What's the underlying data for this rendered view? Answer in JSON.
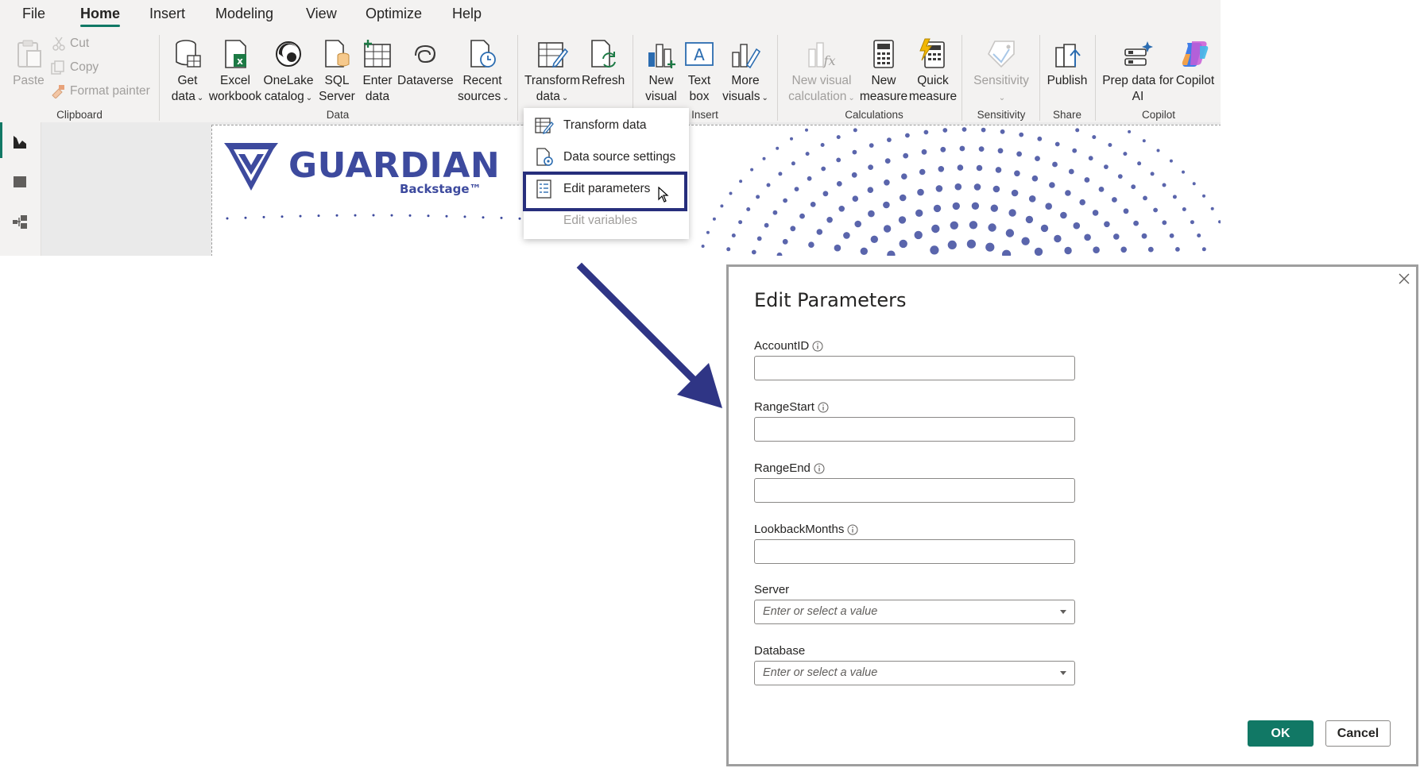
{
  "menu": {
    "tabs": [
      "File",
      "Home",
      "Insert",
      "Modeling",
      "View",
      "Optimize",
      "Help"
    ],
    "active_tab": "Home"
  },
  "ribbon": {
    "clipboard": {
      "paste": "Paste",
      "cut": "Cut",
      "copy": "Copy",
      "format_painter": "Format painter",
      "label": "Clipboard"
    },
    "data": {
      "get_data": [
        "Get",
        "data"
      ],
      "excel_workbook": [
        "Excel",
        "workbook"
      ],
      "onelake_catalog": [
        "OneLake",
        "catalog"
      ],
      "sql_server": [
        "SQL",
        "Server"
      ],
      "enter_data": [
        "Enter",
        "data"
      ],
      "dataverse": "Dataverse",
      "recent_sources": [
        "Recent",
        "sources"
      ],
      "label": "Data"
    },
    "queries": {
      "transform_data": [
        "Transform",
        "data"
      ],
      "refresh": "Refresh"
    },
    "insert": {
      "new_visual": [
        "New",
        "visual"
      ],
      "text_box": [
        "Text",
        "box"
      ],
      "more_visuals": [
        "More",
        "visuals"
      ],
      "label": "Insert"
    },
    "calculations": {
      "new_visual_calculation": [
        "New visual",
        "calculation"
      ],
      "new_measure": [
        "New",
        "measure"
      ],
      "quick_measure": [
        "Quick",
        "measure"
      ],
      "label": "Calculations"
    },
    "sensitivity": {
      "button": "Sensitivity",
      "label": "Sensitivity"
    },
    "share": {
      "publish": "Publish",
      "label": "Share"
    },
    "copilot": {
      "prep_data": [
        "Prep data for",
        "AI"
      ],
      "copilot": "Copilot",
      "label": "Copilot"
    }
  },
  "transform_menu": {
    "items": [
      "Transform data",
      "Data source settings",
      "Edit parameters",
      "Edit variables"
    ],
    "highlighted": "Edit parameters",
    "disabled": [
      "Edit variables"
    ]
  },
  "report": {
    "logo_text": "GUARDIAN",
    "logo_subtext": "Backstage™"
  },
  "dialog": {
    "title": "Edit Parameters",
    "fields": [
      {
        "label": "AccountID",
        "value": ""
      },
      {
        "label": "RangeStart",
        "value": ""
      },
      {
        "label": "RangeEnd",
        "value": ""
      },
      {
        "label": "LookbackMonths",
        "value": ""
      }
    ],
    "selects": [
      {
        "label": "Server",
        "placeholder": "Enter or select a value"
      },
      {
        "label": "Database",
        "placeholder": "Enter or select a value"
      }
    ],
    "ok": "OK",
    "cancel": "Cancel"
  },
  "colors": {
    "accent": "#117865",
    "highlight": "#272e7c",
    "arrow": "#2f3585",
    "logo": "#3d4a9e"
  }
}
